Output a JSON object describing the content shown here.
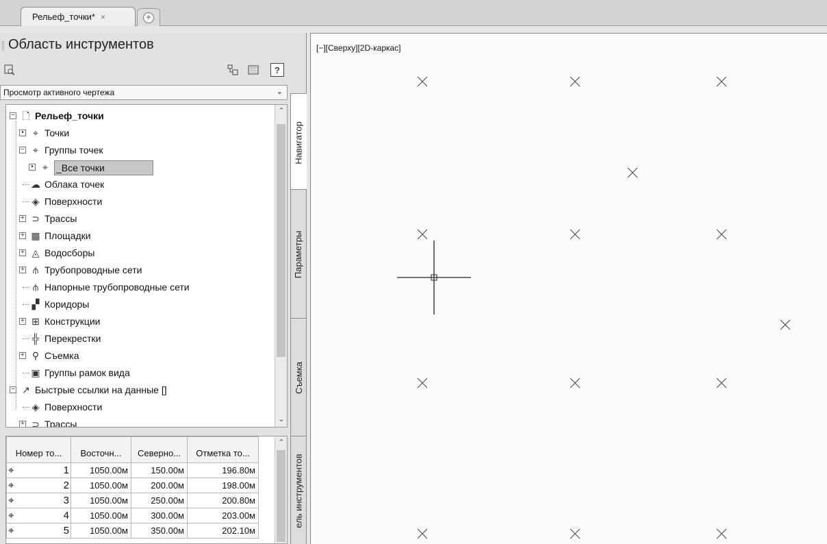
{
  "document_tab": {
    "label": "Рельеф_точки*",
    "close": "×"
  },
  "new_tab": {
    "icon": "new-tab-plus-icon",
    "glyph": "+"
  },
  "toolspace": {
    "title": "Область инструментов",
    "view_select": "Просмотр активного чертежа",
    "help": "?",
    "tabs": [
      "Навигатор",
      "Параметры",
      "Съемка",
      "ель инструментов"
    ]
  },
  "tree": [
    {
      "label": "Рельеф_точки",
      "level": 0,
      "expander": "−",
      "icon": "drawing-icon",
      "glyph": "🗋",
      "bold": true
    },
    {
      "label": "Точки",
      "level": 1,
      "expander": "•",
      "icon": "point-icon",
      "glyph": "⌖"
    },
    {
      "label": "Группы точек",
      "level": 1,
      "expander": "−",
      "icon": "point-group-icon",
      "glyph": "⌖"
    },
    {
      "label": "_Все точки",
      "level": 2,
      "expander": "•",
      "icon": "point-group-icon",
      "glyph": "⌖",
      "selected": true
    },
    {
      "label": "Облака точек",
      "level": 1,
      "expander": "",
      "icon": "point-cloud-icon",
      "glyph": "☁"
    },
    {
      "label": "Поверхности",
      "level": 1,
      "expander": "",
      "icon": "surface-icon",
      "glyph": "◈"
    },
    {
      "label": "Трассы",
      "level": 1,
      "expander": "+",
      "icon": "alignment-icon",
      "glyph": "⊃"
    },
    {
      "label": "Площадки",
      "level": 1,
      "expander": "+",
      "icon": "site-icon",
      "glyph": "▦"
    },
    {
      "label": "Водосборы",
      "level": 1,
      "expander": "+",
      "icon": "catchment-icon",
      "glyph": "◬"
    },
    {
      "label": "Трубопроводные сети",
      "level": 1,
      "expander": "+",
      "icon": "pipe-network-icon",
      "glyph": "⫛"
    },
    {
      "label": "Напорные трубопроводные сети",
      "level": 1,
      "expander": "",
      "icon": "pressure-network-icon",
      "glyph": "⫛"
    },
    {
      "label": "Коридоры",
      "level": 1,
      "expander": "",
      "icon": "corridor-icon",
      "glyph": "▞"
    },
    {
      "label": "Конструкции",
      "level": 1,
      "expander": "+",
      "icon": "assembly-icon",
      "glyph": "⊞"
    },
    {
      "label": "Перекрестки",
      "level": 1,
      "expander": "",
      "icon": "intersection-icon",
      "glyph": "╬"
    },
    {
      "label": "Съемка",
      "level": 1,
      "expander": "+",
      "icon": "survey-icon",
      "glyph": "⚲"
    },
    {
      "label": "Группы рамок вида",
      "level": 1,
      "expander": "",
      "icon": "view-frame-group-icon",
      "glyph": "▣"
    },
    {
      "label": "Быстрые ссылки на данные []",
      "level": 0,
      "expander": "−",
      "icon": "data-shortcut-icon",
      "glyph": "↗"
    },
    {
      "label": "Поверхности",
      "level": 1,
      "expander": "",
      "icon": "surface-icon",
      "glyph": "◈"
    },
    {
      "label": "Трассы",
      "level": 1,
      "expander": "+",
      "icon": "alignment-icon",
      "glyph": "⊃"
    }
  ],
  "table": {
    "columns": [
      "Номер то...",
      "Восточн...",
      "Северно...",
      "Отметка то..."
    ],
    "rows": [
      {
        "number": "1",
        "easting": "1050.00м",
        "northing": "150.00м",
        "elevation": "196.80м"
      },
      {
        "number": "2",
        "easting": "1050.00м",
        "northing": "200.00м",
        "elevation": "198.00м"
      },
      {
        "number": "3",
        "easting": "1050.00м",
        "northing": "250.00м",
        "elevation": "200.80м"
      },
      {
        "number": "4",
        "easting": "1050.00м",
        "northing": "300.00м",
        "elevation": "203.00м"
      },
      {
        "number": "5",
        "easting": "1050.00м",
        "northing": "350.00м",
        "elevation": "202.10м"
      }
    ]
  },
  "viewport": {
    "label": "[−][Сверху][2D-каркас]",
    "marker_count": 14
  }
}
